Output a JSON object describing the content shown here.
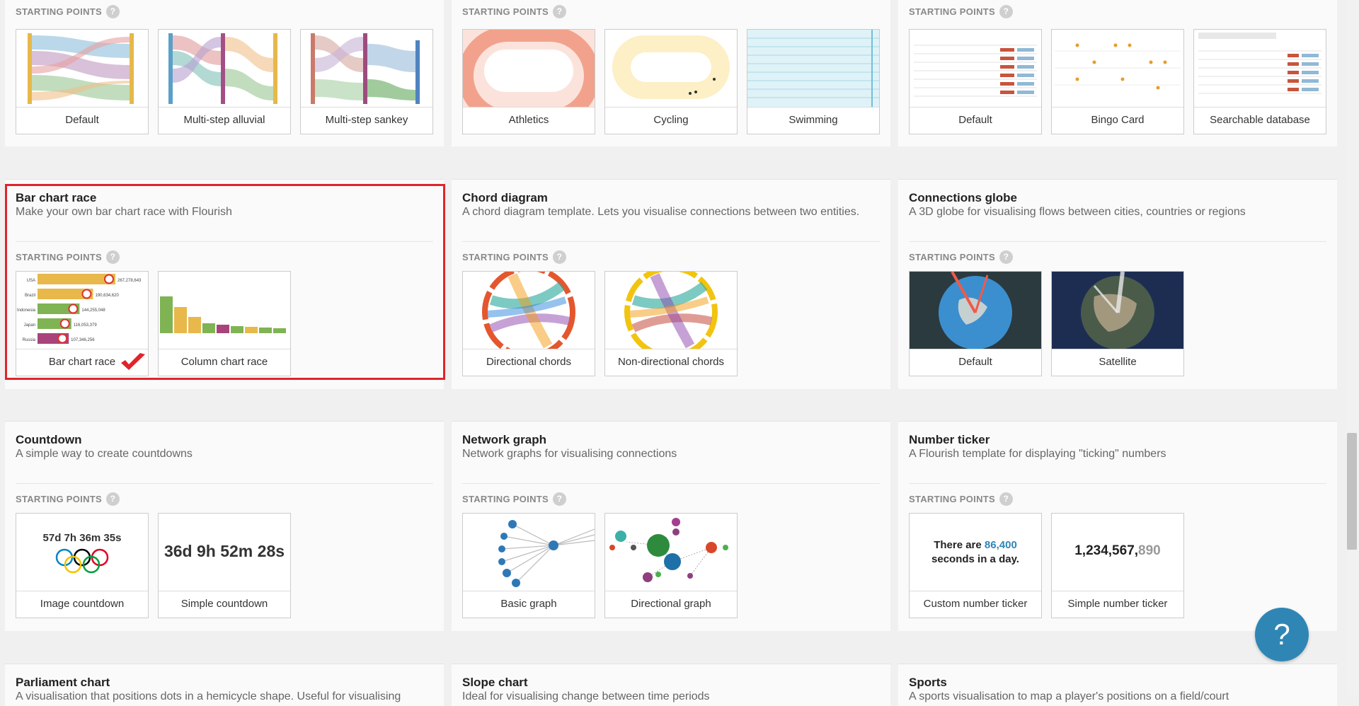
{
  "starting_points_label": "STARTING POINTS",
  "help_glyph": "?",
  "help_button": "?",
  "top_row": [
    {
      "tiles": [
        "Default",
        "Multi-step alluvial",
        "Multi-step sankey"
      ]
    },
    {
      "tiles": [
        "Athletics",
        "Cycling",
        "Swimming"
      ]
    },
    {
      "tiles": [
        "Default",
        "Bingo Card",
        "Searchable database"
      ]
    }
  ],
  "bar_chart_race": {
    "title": "Bar chart race",
    "desc": "Make your own bar chart race with Flourish",
    "tiles": [
      "Bar chart race",
      "Column chart race"
    ],
    "bars": [
      {
        "country": "USA",
        "value": 267278643,
        "value_label": "267,278,643",
        "color": "#e8b84a"
      },
      {
        "country": "Brazil",
        "value": 190634620,
        "value_label": "190,634,620",
        "color": "#e8b84a"
      },
      {
        "country": "Indonesia",
        "value": 144255048,
        "value_label": "144,255,048",
        "color": "#7fb354"
      },
      {
        "country": "Japan",
        "value": 116053379,
        "value_label": "116,053,379",
        "color": "#7fb354"
      },
      {
        "country": "Russia",
        "value": 107346256,
        "value_label": "107,346,256",
        "color": "#a9437b"
      }
    ]
  },
  "chord_diagram": {
    "title": "Chord diagram",
    "desc": "A chord diagram template. Lets you visualise connections between two entities.",
    "tiles": [
      "Directional chords",
      "Non-directional chords"
    ]
  },
  "connections_globe": {
    "title": "Connections globe",
    "desc": "A 3D globe for visualising flows between cities, countries or regions",
    "tiles": [
      "Default",
      "Satellite"
    ]
  },
  "countdown": {
    "title": "Countdown",
    "desc": "A simple way to create countdowns",
    "tiles": [
      "Image countdown",
      "Simple countdown"
    ],
    "image_countdown_text": "57d 7h 36m 35s",
    "simple_countdown_text": "36d 9h 52m 28s"
  },
  "network_graph": {
    "title": "Network graph",
    "desc": "Network graphs for visualising connections",
    "tiles": [
      "Basic graph",
      "Directional graph"
    ]
  },
  "number_ticker": {
    "title": "Number ticker",
    "desc": "A Flourish template for displaying \"ticking\" numbers",
    "tiles": [
      "Custom number ticker",
      "Simple number ticker"
    ],
    "custom_line1_pre": "There are ",
    "custom_number": "86,400",
    "custom_line2": "seconds in a day.",
    "simple_number": "1,234,567,",
    "simple_number_tail": "890"
  },
  "bottom_row": [
    {
      "title": "Parliament chart",
      "desc": "A visualisation that positions dots in a hemicycle shape. Useful for visualising"
    },
    {
      "title": "Slope chart",
      "desc": "Ideal for visualising change between time periods"
    },
    {
      "title": "Sports",
      "desc": "A sports visualisation to map a player's positions on a field/court"
    }
  ],
  "colors": {
    "accent": "#2f86b5",
    "highlight": "#e0242b",
    "check": "#e0242b"
  }
}
